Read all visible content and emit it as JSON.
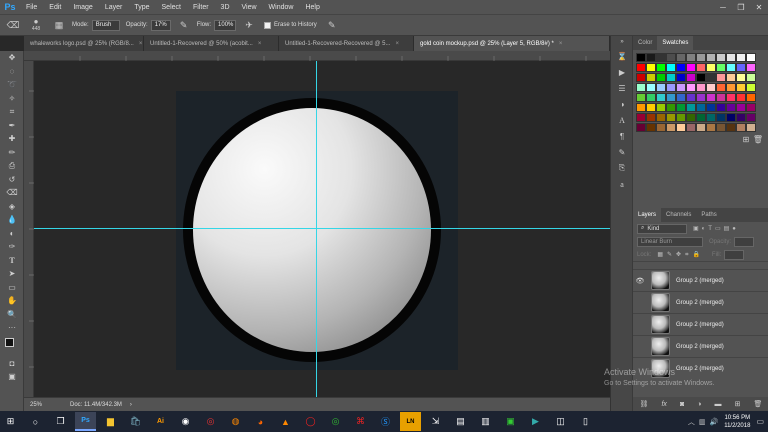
{
  "app": {
    "logo": "Ps"
  },
  "menu": [
    "File",
    "Edit",
    "Image",
    "Layer",
    "Type",
    "Select",
    "Filter",
    "3D",
    "View",
    "Window",
    "Help"
  ],
  "window_controls": [
    "─",
    "❐",
    "✕"
  ],
  "options": {
    "brush_size": "448",
    "mode_label": "Mode:",
    "mode_value": "Brush",
    "opacity_label": "Opacity:",
    "opacity_value": "17%",
    "flow_label": "Flow:",
    "flow_value": "100%",
    "erase_history_label": "Erase to History"
  },
  "tabs": [
    {
      "label": "whaleworks logo.psd @ 25% (RGB/8...",
      "active": false
    },
    {
      "label": "Untitled-1-Recovered @ 50% (acobit...",
      "active": false
    },
    {
      "label": "Untitled-1-Recovered-Recovered @ 5...",
      "active": false
    },
    {
      "label": "gold coin mockup.psd @ 25% (Layer 5, RGB/8#) *",
      "active": true
    }
  ],
  "status": {
    "zoom": "25%",
    "doc": "Doc: 11.4M/342.3M"
  },
  "swatch_panel": {
    "tabs": [
      "Color",
      "Swatches"
    ],
    "colors": [
      "#000000",
      "#1a1a1a",
      "#333333",
      "#4d4d4d",
      "#666666",
      "#808080",
      "#999999",
      "#b3b3b3",
      "#cccccc",
      "#e6e6e6",
      "#f2f2f2",
      "#ffffff",
      "#ff0000",
      "#ffff00",
      "#00ff00",
      "#00ffff",
      "#0000ff",
      "#ff00ff",
      "#ff6666",
      "#ffff66",
      "#66ff66",
      "#66ffff",
      "#6666ff",
      "#ff66ff",
      "#cc0000",
      "#cccc00",
      "#00cc00",
      "#00cccc",
      "#0000cc",
      "#cc00cc",
      "#000000",
      "#333333",
      "#ff9999",
      "#ffcc99",
      "#ffff99",
      "#ccff99",
      "#99ffcc",
      "#99ffff",
      "#99ccff",
      "#9999ff",
      "#cc99ff",
      "#ff99ff",
      "#ff99cc",
      "#ffcccc",
      "#ff6633",
      "#ff9933",
      "#ffcc33",
      "#ccff33",
      "#66cc33",
      "#33cc66",
      "#33cccc",
      "#3399cc",
      "#3366cc",
      "#6633cc",
      "#9933cc",
      "#cc33cc",
      "#cc3399",
      "#ff3366",
      "#ff3333",
      "#ff6600",
      "#ff9900",
      "#ffcc00",
      "#99cc00",
      "#339900",
      "#009933",
      "#009999",
      "#006699",
      "#003399",
      "#330099",
      "#660099",
      "#990099",
      "#990066",
      "#990033",
      "#993300",
      "#996600",
      "#999900",
      "#669900",
      "#336600",
      "#006633",
      "#006666",
      "#003366",
      "#000066",
      "#330066",
      "#660066",
      "#660033",
      "#663300",
      "#996633",
      "#cc9966",
      "#ffcc99",
      "#996666",
      "#ccaa88",
      "#aa7744",
      "#775533",
      "#553311",
      "#b08060",
      "#d0b090"
    ]
  },
  "layers_panel": {
    "tabs": [
      "Layers",
      "Channels",
      "Paths"
    ],
    "filter_label": "Kind",
    "blend_mode": "Linear Burn",
    "opacity_label": "Opacity:",
    "lock_label": "Lock:",
    "fill_label": "Fill:",
    "layers": [
      {
        "name": "Group 2 (merged)",
        "visible": true
      },
      {
        "name": "Group 2 (merged)",
        "visible": false
      },
      {
        "name": "Group 2 (merged)",
        "visible": false
      },
      {
        "name": "Group 2 (merged)",
        "visible": false
      },
      {
        "name": "Group 2 (merged)",
        "visible": false
      }
    ],
    "footer_icons": [
      "link-icon",
      "fx-icon",
      "mask-icon",
      "adjustment-icon",
      "folder-icon",
      "new-layer-icon",
      "trash-icon"
    ]
  },
  "watermark": {
    "title": "Activate Windows",
    "subtitle": "Go to Settings to activate Windows."
  },
  "taskbar": {
    "time": "10:56 PM",
    "date": "11/2/2018",
    "apps": [
      "start",
      "search",
      "task-view",
      "photoshop",
      "explorer",
      "store",
      "illustrator",
      "obs",
      "chrome",
      "cat",
      "firefox",
      "vlc",
      "opera",
      "chrome2",
      "acrobat",
      "skype",
      "ln",
      "figma",
      "files",
      "app",
      "green-app",
      "maps",
      "camera",
      "app2"
    ]
  },
  "colors": {
    "guide": "#35d6e6",
    "doc_bg": "#1c2329",
    "chrome": "#535353"
  }
}
